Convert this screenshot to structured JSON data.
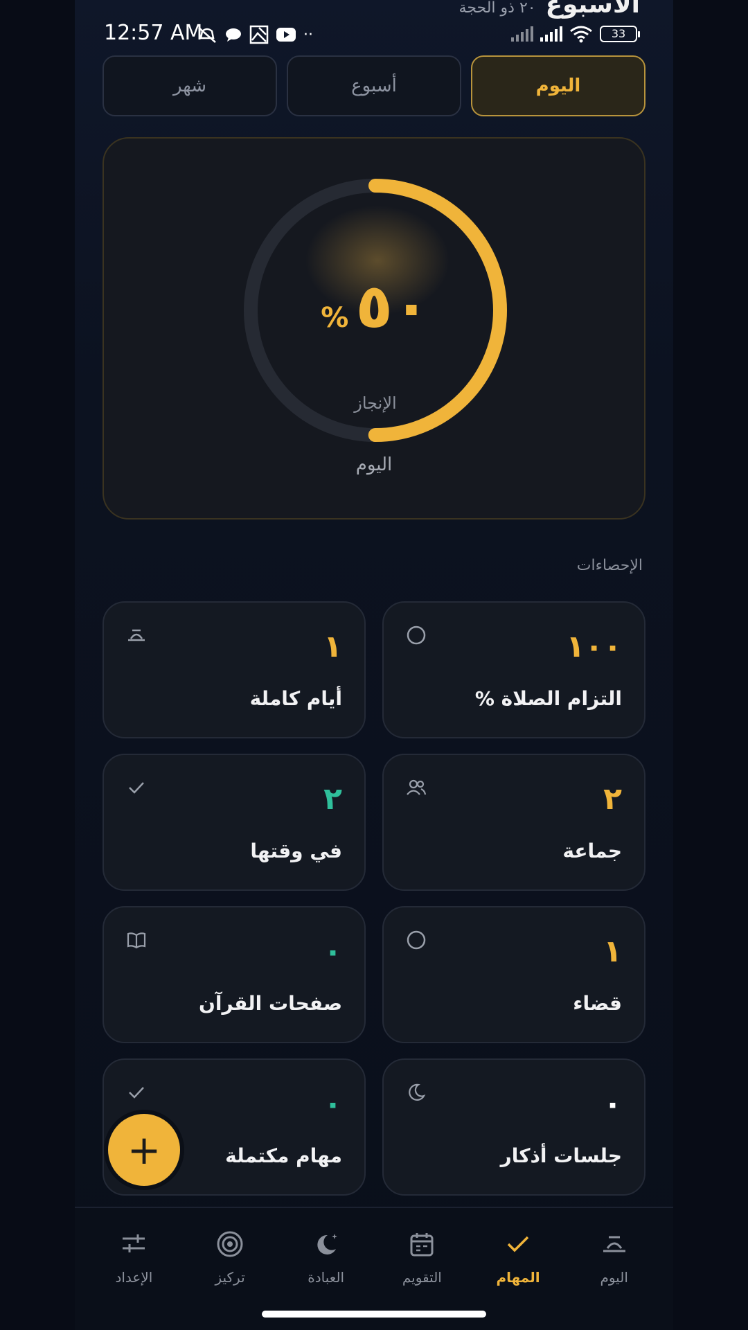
{
  "header": {
    "title": "الأسبوع",
    "subtitle": "٢٠ ذو الحجة"
  },
  "status_bar": {
    "time": "12:57 AM",
    "battery": "33"
  },
  "tabs": [
    {
      "label": "اليوم",
      "active": true
    },
    {
      "label": "أسبوع",
      "active": false
    },
    {
      "label": "شهر",
      "active": false
    }
  ],
  "progress": {
    "value_text": "٥٠",
    "percent_sign": "%",
    "fraction": 0.5,
    "label": "الإنجاز",
    "period": "اليوم",
    "accent": "#f0b43a"
  },
  "stats_title": "الإحصاءات",
  "stats": [
    {
      "value": "١٠٠",
      "label": "التزام الصلاة %",
      "icon": "circle-icon",
      "color": "#f0b43a"
    },
    {
      "value": "١",
      "label": "أيام كاملة",
      "icon": "sunrise-icon",
      "color": "#f0b43a"
    },
    {
      "value": "٢",
      "label": "جماعة",
      "icon": "users-icon",
      "color": "#f0b43a"
    },
    {
      "value": "٢",
      "label": "في وقتها",
      "icon": "check-icon",
      "color": "#2fbf9b"
    },
    {
      "value": "١",
      "label": "قضاء",
      "icon": "circle-icon",
      "color": "#f0b43a"
    },
    {
      "value": "٠",
      "label": "صفحات القرآن",
      "icon": "book-icon",
      "color": "#2fbf9b"
    },
    {
      "value": "٠",
      "label": "جلسات أذكار",
      "icon": "moon-icon",
      "color": "#ffffff"
    },
    {
      "value": "٠",
      "label": "مهام مكتملة",
      "icon": "check-icon",
      "color": "#2fbf9b"
    }
  ],
  "fab": {
    "label": "+"
  },
  "bottom_nav": [
    {
      "label": "اليوم",
      "icon": "sunrise-icon",
      "active": false
    },
    {
      "label": "المهام",
      "icon": "check-icon",
      "active": true
    },
    {
      "label": "التقويم",
      "icon": "calendar-icon",
      "active": false
    },
    {
      "label": "العبادة",
      "icon": "moon-star-icon",
      "active": false
    },
    {
      "label": "تركيز",
      "icon": "target-icon",
      "active": false
    },
    {
      "label": "الإعداد",
      "icon": "sliders-icon",
      "active": false
    }
  ]
}
